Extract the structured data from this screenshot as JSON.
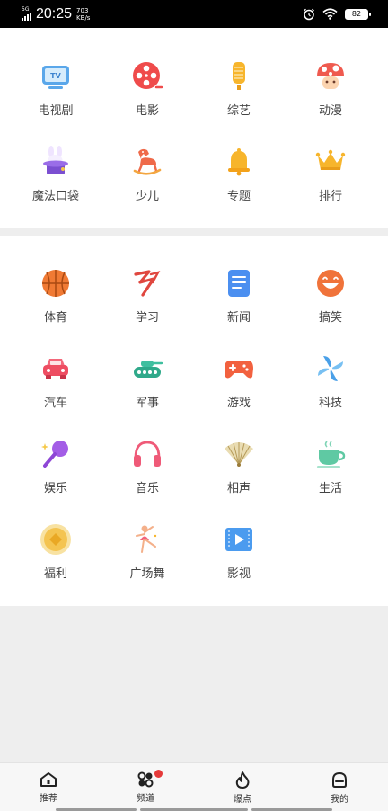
{
  "status_bar": {
    "network": "5G",
    "time": "20:25",
    "speed_value": "703",
    "speed_unit": "KB/s",
    "battery": "82"
  },
  "section_top": [
    {
      "label": "电视剧",
      "icon": "tv-icon"
    },
    {
      "label": "电影",
      "icon": "film-reel-icon"
    },
    {
      "label": "综艺",
      "icon": "microphone-icon"
    },
    {
      "label": "动漫",
      "icon": "mushroom-icon"
    },
    {
      "label": "魔法口袋",
      "icon": "magic-hat-icon"
    },
    {
      "label": "少儿",
      "icon": "rocking-horse-icon"
    },
    {
      "label": "专题",
      "icon": "bell-icon"
    },
    {
      "label": "排行",
      "icon": "crown-icon"
    }
  ],
  "section_bottom": [
    {
      "label": "体育",
      "icon": "basketball-icon"
    },
    {
      "label": "学习",
      "icon": "learning-icon"
    },
    {
      "label": "新闻",
      "icon": "news-icon"
    },
    {
      "label": "搞笑",
      "icon": "laugh-face-icon"
    },
    {
      "label": "汽车",
      "icon": "car-icon"
    },
    {
      "label": "军事",
      "icon": "tank-icon"
    },
    {
      "label": "游戏",
      "icon": "gamepad-icon"
    },
    {
      "label": "科技",
      "icon": "pinwheel-icon"
    },
    {
      "label": "娱乐",
      "icon": "karaoke-mic-icon"
    },
    {
      "label": "音乐",
      "icon": "headphones-icon"
    },
    {
      "label": "相声",
      "icon": "folding-fan-icon"
    },
    {
      "label": "生活",
      "icon": "coffee-cup-icon"
    },
    {
      "label": "福利",
      "icon": "coin-icon"
    },
    {
      "label": "广场舞",
      "icon": "dancer-icon"
    },
    {
      "label": "影视",
      "icon": "video-play-icon"
    }
  ],
  "bottom_nav": [
    {
      "label": "推荐",
      "icon": "home-icon"
    },
    {
      "label": "频道",
      "icon": "channels-icon"
    },
    {
      "label": "爆点",
      "icon": "flame-icon"
    },
    {
      "label": "我的",
      "icon": "profile-icon"
    }
  ]
}
